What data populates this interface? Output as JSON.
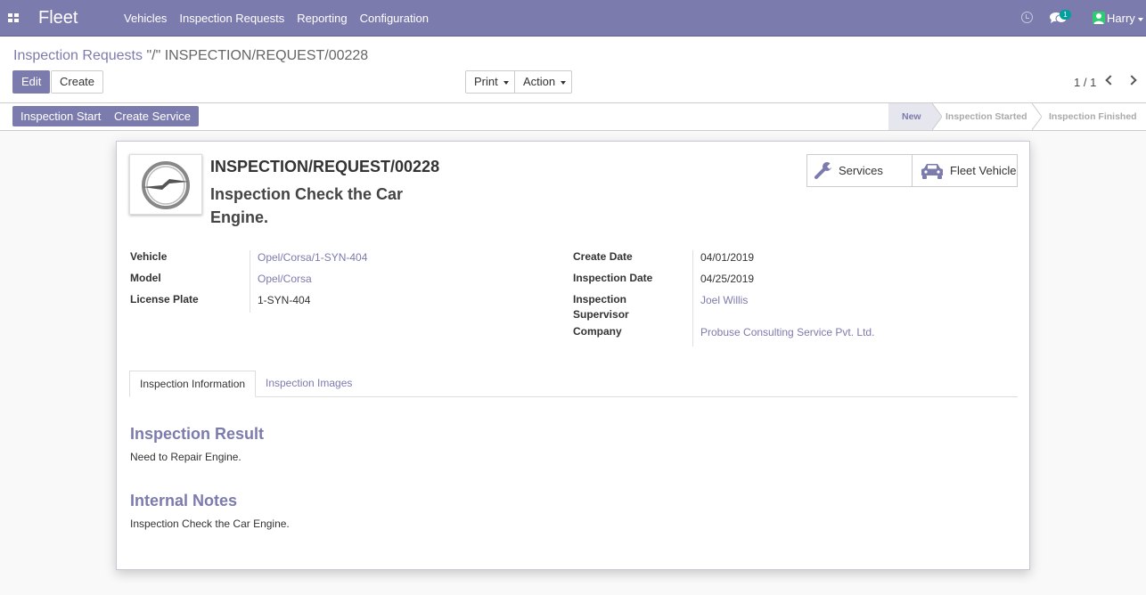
{
  "navbar": {
    "brand": "Fleet",
    "menu": [
      "Vehicles",
      "Inspection Requests",
      "Reporting",
      "Configuration"
    ],
    "chat_badge": "1",
    "user": "Harry"
  },
  "control_panel": {
    "breadcrumb_parent": "Inspection Requests",
    "breadcrumb_current": "\"/\" INSPECTION/REQUEST/00228",
    "edit_label": "Edit",
    "create_label": "Create",
    "print_label": "Print",
    "action_label": "Action",
    "pager_value": "1 / 1"
  },
  "statusbar": {
    "buttons": [
      "Inspection Start",
      "Create Service"
    ],
    "stages": [
      "New",
      "Inspection Started",
      "Inspection Finished"
    ],
    "active_stage": "New"
  },
  "form": {
    "reference": "INSPECTION/REQUEST/00228",
    "name": "Inspection Check the Car Engine.",
    "smart_buttons": {
      "services": "Services",
      "fleet_vehicle": "Fleet Vehicle"
    },
    "left_fields": [
      {
        "label": "Vehicle",
        "value": "Opel/Corsa/1-SYN-404",
        "link": true
      },
      {
        "label": "Model",
        "value": "Opel/Corsa",
        "link": true
      },
      {
        "label": "License Plate",
        "value": "1-SYN-404",
        "link": false
      }
    ],
    "right_fields": [
      {
        "label": "Create Date",
        "value": "04/01/2019",
        "link": false
      },
      {
        "label": "Inspection Date",
        "value": "04/25/2019",
        "link": false
      },
      {
        "label": "Inspection Supervisor",
        "value": "Joel Willis",
        "link": true
      },
      {
        "label": "Company",
        "value": "Probuse Consulting Service Pvt. Ltd.",
        "link": true
      }
    ],
    "tabs": [
      "Inspection Information",
      "Inspection Images"
    ],
    "inspection_result_title": "Inspection Result",
    "inspection_result_text": "Need to Repair Engine.",
    "internal_notes_title": "Internal Notes",
    "internal_notes_text": "Inspection Check the Car Engine."
  },
  "colors": {
    "primary": "#7c7bad",
    "text": "#4c4c4c",
    "badge": "#00a09d"
  },
  "icons": [
    "apps-icon",
    "clock-icon",
    "chat-icon",
    "user-avatar-icon",
    "wrench-icon",
    "car-icon",
    "chevron-left-icon",
    "chevron-right-icon",
    "opel-logo"
  ]
}
